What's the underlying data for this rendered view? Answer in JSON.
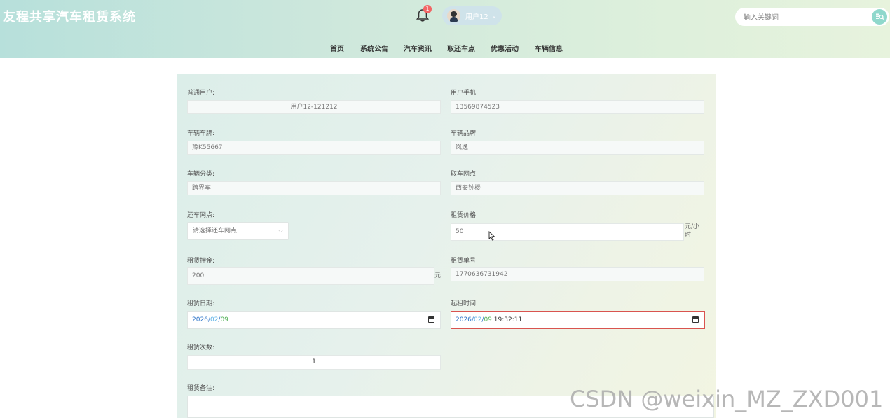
{
  "header": {
    "app_title": "友程共享汽车租赁系统",
    "notification_count": "1",
    "user_name": "用户12",
    "user_caret": "⌄",
    "search_placeholder": "输入关键词",
    "search_icon": "search-icon"
  },
  "nav": [
    "首页",
    "系统公告",
    "汽车资讯",
    "取还车点",
    "优惠活动",
    "车辆信息"
  ],
  "form": {
    "normal_user_label": "普通用户:",
    "normal_user_value": "用户12-121212",
    "user_phone_label": "用户手机:",
    "user_phone_value": "13569874523",
    "plate_label": "车辆车牌:",
    "plate_value": "豫K55667",
    "brand_label": "车辆品牌:",
    "brand_value": "岚逸",
    "category_label": "车辆分类:",
    "category_value": "跨界车",
    "pickup_label": "取车网点:",
    "pickup_value": "西安钟楼",
    "return_label": "还车网点:",
    "return_placeholder": "请选择还车网点",
    "price_label": "租赁价格:",
    "price_value": "50",
    "price_unit": "元/小时",
    "deposit_label": "租赁押金:",
    "deposit_value": "200",
    "deposit_unit": "元",
    "order_no_label": "租赁单号:",
    "order_no_value": "1770636731942",
    "date_label": "租赁日期:",
    "date_year": "2026",
    "date_month": "02",
    "date_day": "09",
    "start_time_label": "起租时间:",
    "start_year": "2026",
    "start_month": "02",
    "start_day": "09",
    "start_clock": "19:32:11",
    "times_label": "租赁次数:",
    "times_value": "1",
    "remark_label": "租赁备注:"
  },
  "watermark": "CSDN @weixin_MZ_ZXD001",
  "colors": {
    "header_gradient_start": "#b7e0db",
    "header_gradient_end": "#e7f3dd",
    "badge": "#f26565",
    "invalid_border": "#d9534f",
    "search_button": "#8fd8cc"
  }
}
